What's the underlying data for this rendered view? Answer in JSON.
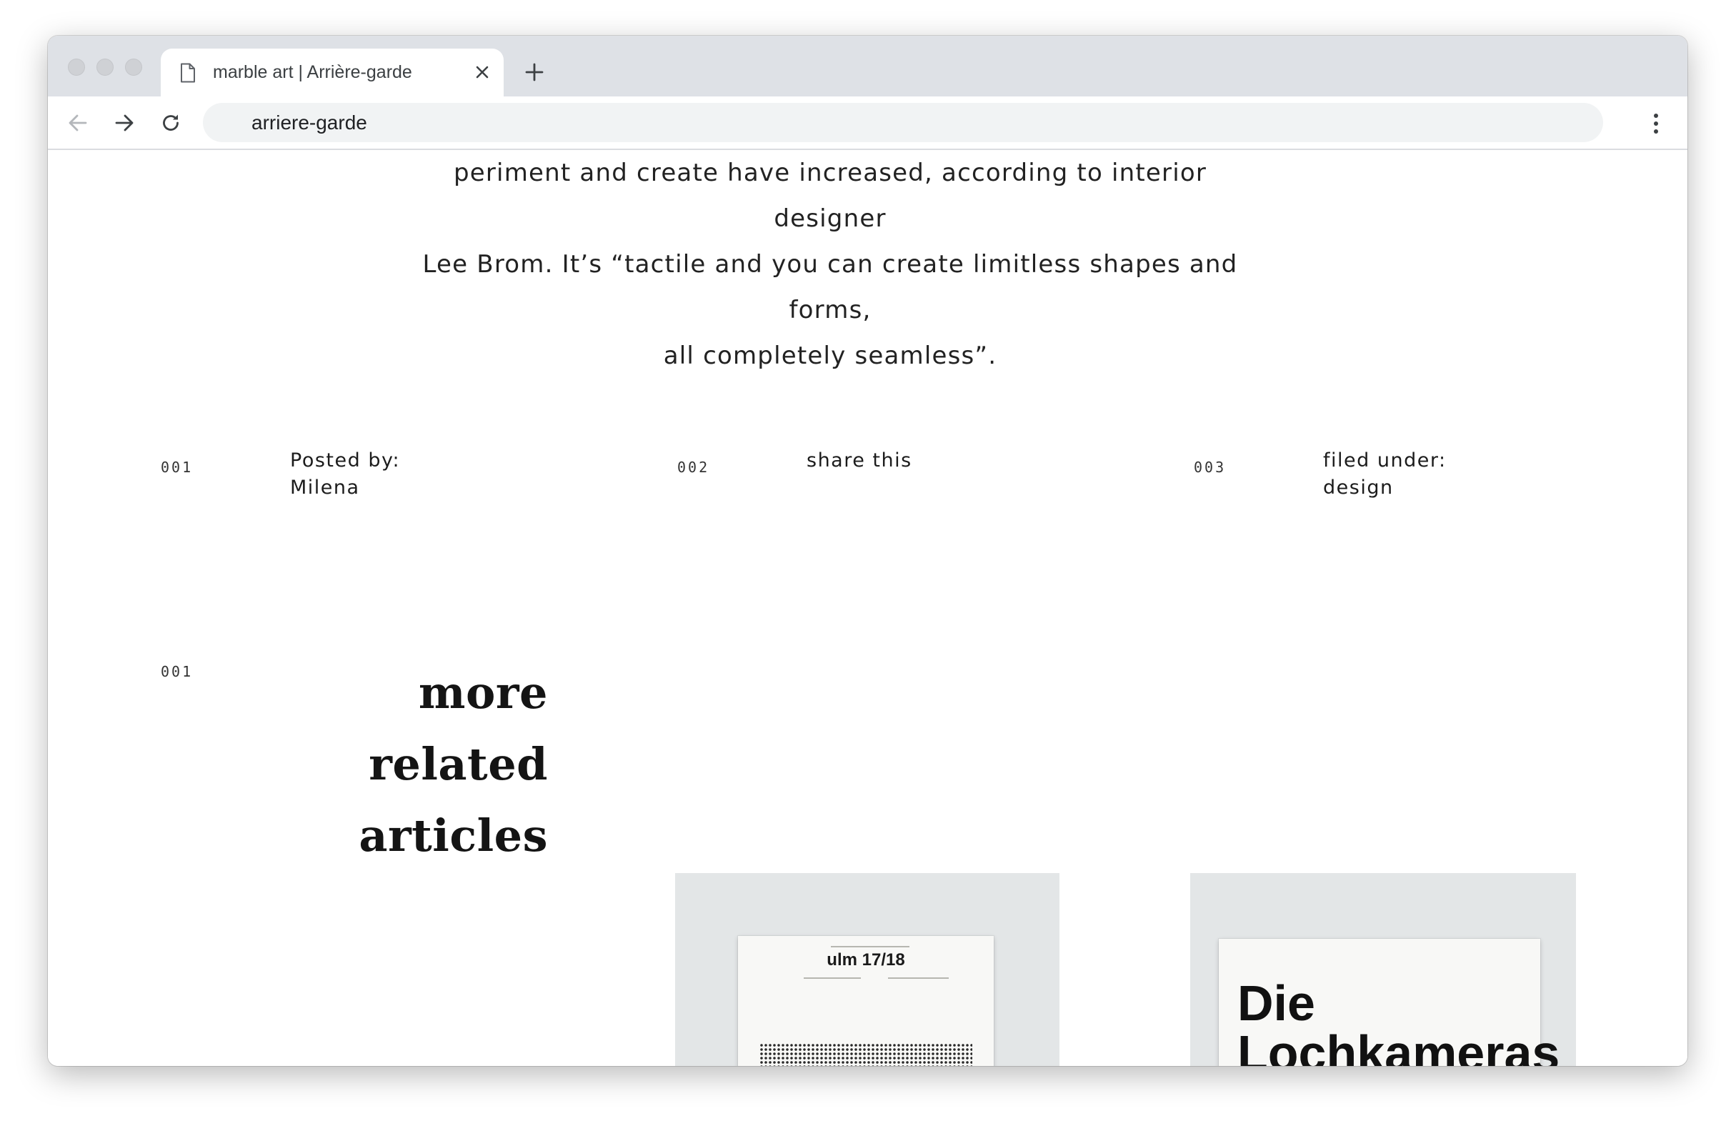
{
  "browser": {
    "tab": {
      "title": "marble art | Arrière-garde"
    },
    "address_bar": {
      "url": "arriere-garde"
    }
  },
  "article": {
    "lines": [
      "periment and create have increased, according to interior designer",
      "Lee Brom. It’s “tactile and you can create limitless shapes and forms,",
      "all completely seamless”."
    ]
  },
  "meta": [
    {
      "number": "001",
      "lines": [
        "Posted by:",
        "Milena"
      ]
    },
    {
      "number": "002",
      "lines": [
        "share this"
      ]
    },
    {
      "number": "003",
      "lines": [
        "filed under:",
        "design"
      ]
    }
  ],
  "related": {
    "number": "001",
    "heading_lines": [
      "more",
      "related",
      "articles"
    ],
    "cards": [
      {
        "cover_title": "ulm 17/18"
      },
      {
        "cover_lines": [
          "Die",
          "Lochkameras"
        ]
      }
    ]
  },
  "colors": {
    "tab_strip": "#dee1e6",
    "omnibox": "#f1f3f4",
    "text": "#222222",
    "thumbnail_bg": "#e3e6e7"
  },
  "icons": [
    "page-icon",
    "close-icon",
    "plus-icon",
    "back-arrow-icon",
    "forward-arrow-icon",
    "reload-icon",
    "more-vert-icon"
  ]
}
